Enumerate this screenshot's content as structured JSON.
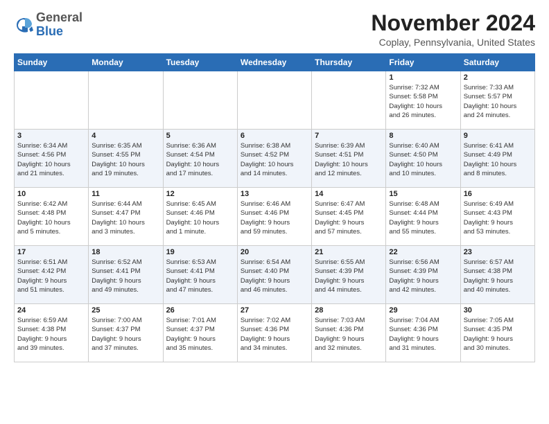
{
  "logo": {
    "general": "General",
    "blue": "Blue"
  },
  "title": "November 2024",
  "subtitle": "Coplay, Pennsylvania, United States",
  "days_header": [
    "Sunday",
    "Monday",
    "Tuesday",
    "Wednesday",
    "Thursday",
    "Friday",
    "Saturday"
  ],
  "weeks": [
    [
      {
        "num": "",
        "info": ""
      },
      {
        "num": "",
        "info": ""
      },
      {
        "num": "",
        "info": ""
      },
      {
        "num": "",
        "info": ""
      },
      {
        "num": "",
        "info": ""
      },
      {
        "num": "1",
        "info": "Sunrise: 7:32 AM\nSunset: 5:58 PM\nDaylight: 10 hours\nand 26 minutes."
      },
      {
        "num": "2",
        "info": "Sunrise: 7:33 AM\nSunset: 5:57 PM\nDaylight: 10 hours\nand 24 minutes."
      }
    ],
    [
      {
        "num": "3",
        "info": "Sunrise: 6:34 AM\nSunset: 4:56 PM\nDaylight: 10 hours\nand 21 minutes."
      },
      {
        "num": "4",
        "info": "Sunrise: 6:35 AM\nSunset: 4:55 PM\nDaylight: 10 hours\nand 19 minutes."
      },
      {
        "num": "5",
        "info": "Sunrise: 6:36 AM\nSunset: 4:54 PM\nDaylight: 10 hours\nand 17 minutes."
      },
      {
        "num": "6",
        "info": "Sunrise: 6:38 AM\nSunset: 4:52 PM\nDaylight: 10 hours\nand 14 minutes."
      },
      {
        "num": "7",
        "info": "Sunrise: 6:39 AM\nSunset: 4:51 PM\nDaylight: 10 hours\nand 12 minutes."
      },
      {
        "num": "8",
        "info": "Sunrise: 6:40 AM\nSunset: 4:50 PM\nDaylight: 10 hours\nand 10 minutes."
      },
      {
        "num": "9",
        "info": "Sunrise: 6:41 AM\nSunset: 4:49 PM\nDaylight: 10 hours\nand 8 minutes."
      }
    ],
    [
      {
        "num": "10",
        "info": "Sunrise: 6:42 AM\nSunset: 4:48 PM\nDaylight: 10 hours\nand 5 minutes."
      },
      {
        "num": "11",
        "info": "Sunrise: 6:44 AM\nSunset: 4:47 PM\nDaylight: 10 hours\nand 3 minutes."
      },
      {
        "num": "12",
        "info": "Sunrise: 6:45 AM\nSunset: 4:46 PM\nDaylight: 10 hours\nand 1 minute."
      },
      {
        "num": "13",
        "info": "Sunrise: 6:46 AM\nSunset: 4:46 PM\nDaylight: 9 hours\nand 59 minutes."
      },
      {
        "num": "14",
        "info": "Sunrise: 6:47 AM\nSunset: 4:45 PM\nDaylight: 9 hours\nand 57 minutes."
      },
      {
        "num": "15",
        "info": "Sunrise: 6:48 AM\nSunset: 4:44 PM\nDaylight: 9 hours\nand 55 minutes."
      },
      {
        "num": "16",
        "info": "Sunrise: 6:49 AM\nSunset: 4:43 PM\nDaylight: 9 hours\nand 53 minutes."
      }
    ],
    [
      {
        "num": "17",
        "info": "Sunrise: 6:51 AM\nSunset: 4:42 PM\nDaylight: 9 hours\nand 51 minutes."
      },
      {
        "num": "18",
        "info": "Sunrise: 6:52 AM\nSunset: 4:41 PM\nDaylight: 9 hours\nand 49 minutes."
      },
      {
        "num": "19",
        "info": "Sunrise: 6:53 AM\nSunset: 4:41 PM\nDaylight: 9 hours\nand 47 minutes."
      },
      {
        "num": "20",
        "info": "Sunrise: 6:54 AM\nSunset: 4:40 PM\nDaylight: 9 hours\nand 46 minutes."
      },
      {
        "num": "21",
        "info": "Sunrise: 6:55 AM\nSunset: 4:39 PM\nDaylight: 9 hours\nand 44 minutes."
      },
      {
        "num": "22",
        "info": "Sunrise: 6:56 AM\nSunset: 4:39 PM\nDaylight: 9 hours\nand 42 minutes."
      },
      {
        "num": "23",
        "info": "Sunrise: 6:57 AM\nSunset: 4:38 PM\nDaylight: 9 hours\nand 40 minutes."
      }
    ],
    [
      {
        "num": "24",
        "info": "Sunrise: 6:59 AM\nSunset: 4:38 PM\nDaylight: 9 hours\nand 39 minutes."
      },
      {
        "num": "25",
        "info": "Sunrise: 7:00 AM\nSunset: 4:37 PM\nDaylight: 9 hours\nand 37 minutes."
      },
      {
        "num": "26",
        "info": "Sunrise: 7:01 AM\nSunset: 4:37 PM\nDaylight: 9 hours\nand 35 minutes."
      },
      {
        "num": "27",
        "info": "Sunrise: 7:02 AM\nSunset: 4:36 PM\nDaylight: 9 hours\nand 34 minutes."
      },
      {
        "num": "28",
        "info": "Sunrise: 7:03 AM\nSunset: 4:36 PM\nDaylight: 9 hours\nand 32 minutes."
      },
      {
        "num": "29",
        "info": "Sunrise: 7:04 AM\nSunset: 4:36 PM\nDaylight: 9 hours\nand 31 minutes."
      },
      {
        "num": "30",
        "info": "Sunrise: 7:05 AM\nSunset: 4:35 PM\nDaylight: 9 hours\nand 30 minutes."
      }
    ]
  ]
}
